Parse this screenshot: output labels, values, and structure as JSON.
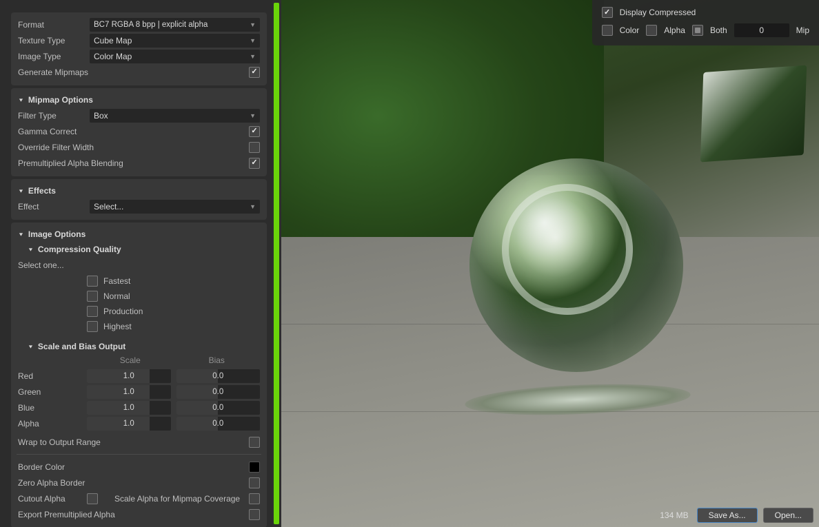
{
  "props": {
    "format": {
      "label": "Format",
      "value": "BC7     RGBA   8 bpp | explicit alpha"
    },
    "textureType": {
      "label": "Texture Type",
      "value": "Cube Map"
    },
    "imageType": {
      "label": "Image Type",
      "value": "Color Map"
    },
    "generateMipmaps": {
      "label": "Generate Mipmaps",
      "checked": true
    }
  },
  "mipmap": {
    "title": "Mipmap Options",
    "filterType": {
      "label": "Filter Type",
      "value": "Box"
    },
    "gammaCorrect": {
      "label": "Gamma Correct",
      "checked": true
    },
    "overrideFilterWidth": {
      "label": "Override Filter Width",
      "checked": false
    },
    "premultipliedAlpha": {
      "label": "Premultiplied Alpha Blending",
      "checked": true
    }
  },
  "effects": {
    "title": "Effects",
    "effect": {
      "label": "Effect",
      "value": "Select..."
    }
  },
  "imageOptions": {
    "title": "Image Options",
    "compressionQuality": {
      "title": "Compression Quality",
      "prompt": "Select one...",
      "options": [
        "Fastest",
        "Normal",
        "Production",
        "Highest"
      ]
    },
    "scaleBias": {
      "title": "Scale and Bias Output",
      "scaleHeader": "Scale",
      "biasHeader": "Bias",
      "channels": [
        {
          "name": "Red",
          "scale": "1.0",
          "bias": "0.0"
        },
        {
          "name": "Green",
          "scale": "1.0",
          "bias": "0.0"
        },
        {
          "name": "Blue",
          "scale": "1.0",
          "bias": "0.0"
        },
        {
          "name": "Alpha",
          "scale": "1.0",
          "bias": "0.0"
        }
      ],
      "wrapToOutputRange": {
        "label": "Wrap to Output Range",
        "checked": false
      }
    },
    "borderColor": {
      "label": "Border Color"
    },
    "zeroAlphaBorder": {
      "label": "Zero Alpha Border",
      "checked": false
    },
    "cutoutAlpha": {
      "label": "Cutout Alpha",
      "checked": false
    },
    "scaleAlphaMipCoverage": {
      "label": "Scale Alpha for Mipmap Coverage",
      "checked": false
    },
    "exportPremultipliedAlpha": {
      "label": "Export Premultiplied Alpha",
      "checked": false
    }
  },
  "overlay": {
    "displayCompressed": {
      "label": "Display Compressed",
      "checked": true
    },
    "colorLabel": "Color",
    "alphaLabel": "Alpha",
    "bothLabel": "Both",
    "mipValue": "0",
    "mipLabel": "Mip"
  },
  "footer": {
    "size": "134 MB",
    "saveAs": "Save As...",
    "open": "Open..."
  }
}
